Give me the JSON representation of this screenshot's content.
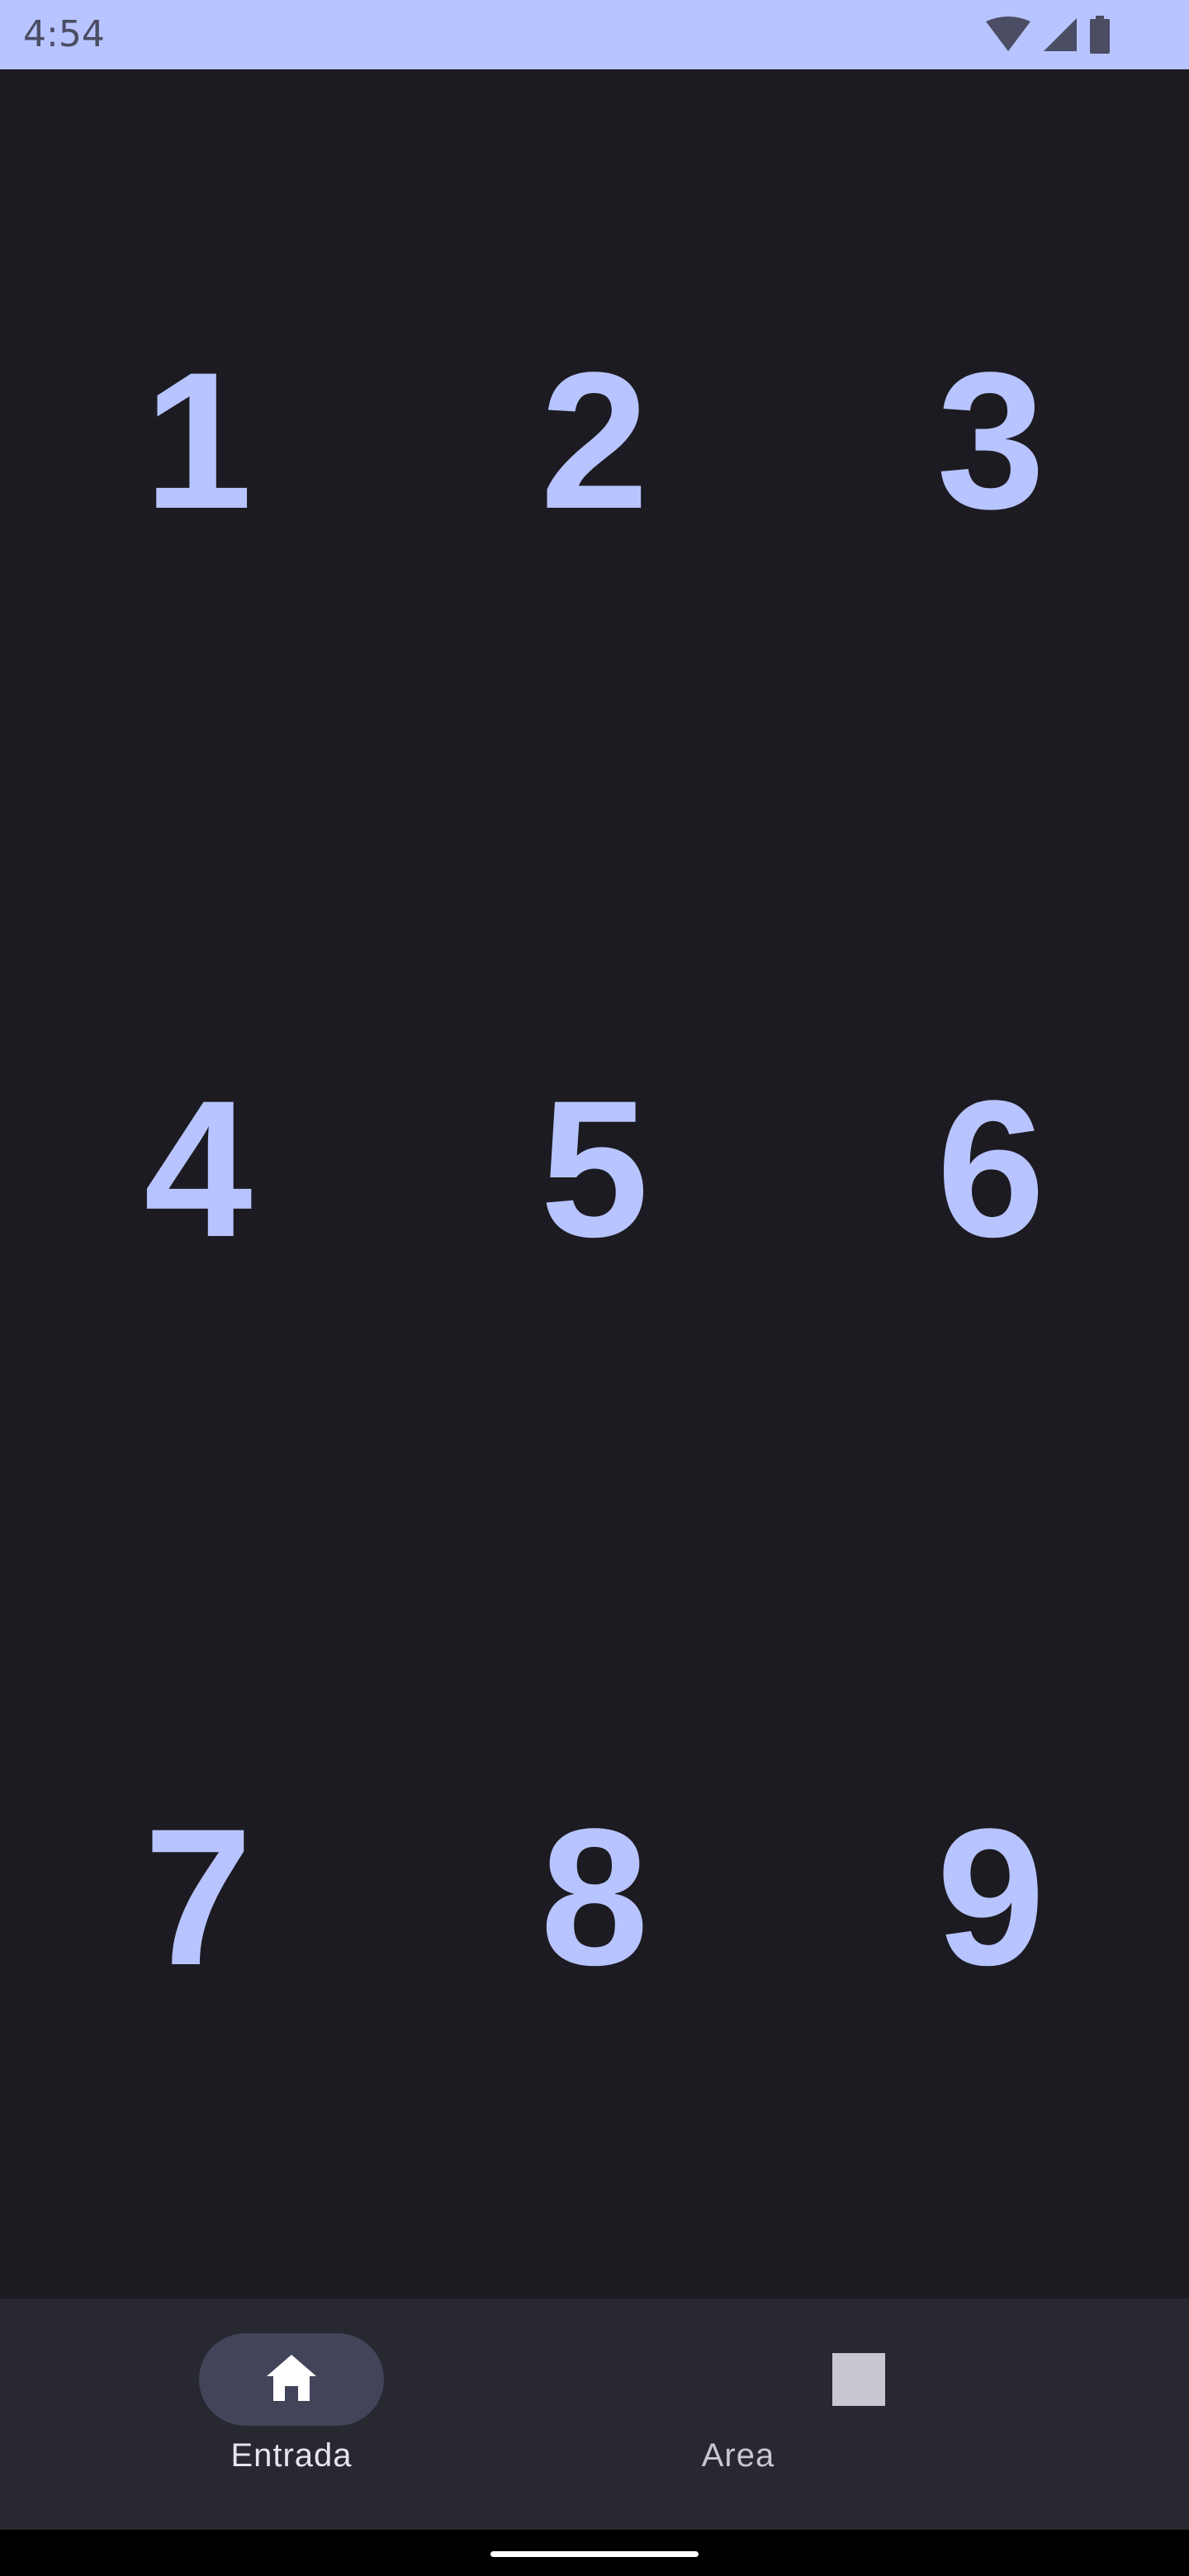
{
  "status_bar": {
    "time": "4:54",
    "icons": [
      "wifi-icon",
      "signal-icon",
      "battery-icon"
    ]
  },
  "keypad": {
    "digits": [
      "1",
      "2",
      "3",
      "4",
      "5",
      "6",
      "7",
      "8",
      "9"
    ]
  },
  "bottom_nav": {
    "items": [
      {
        "label": "Entrada",
        "icon": "home-icon",
        "selected": true
      },
      {
        "label": "Area",
        "icon": "square-icon",
        "selected": false
      }
    ]
  },
  "colors": {
    "status_bar_bg": "#b7c4ff",
    "background": "#1c1b21",
    "digit": "#b7c4ff",
    "nav_bg": "#282830",
    "nav_pill": "#42455a"
  }
}
